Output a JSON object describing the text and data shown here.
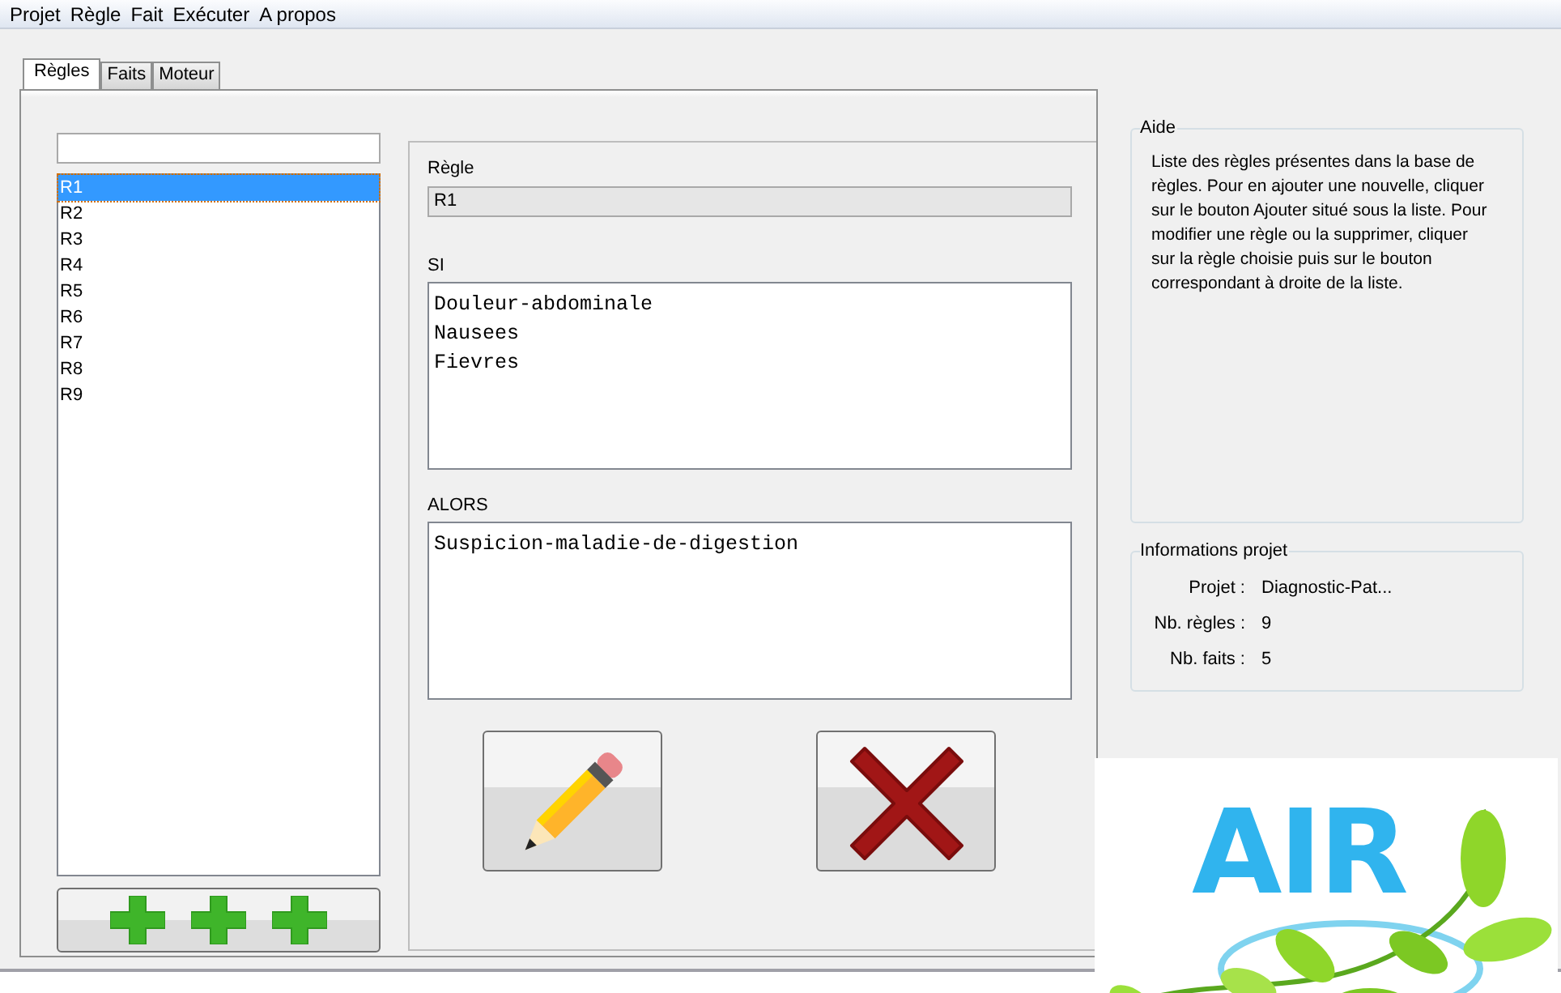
{
  "menu": [
    "Projet",
    "Règle",
    "Fait",
    "Exécuter",
    "A propos"
  ],
  "tabs": [
    {
      "label": "Règles",
      "selected": true
    },
    {
      "label": "Faits",
      "selected": false
    },
    {
      "label": "Moteur",
      "selected": false
    }
  ],
  "rules": [
    {
      "label": "R1",
      "selected": true
    },
    {
      "label": "R2",
      "selected": false
    },
    {
      "label": "R3",
      "selected": false
    },
    {
      "label": "R4",
      "selected": false
    },
    {
      "label": "R5",
      "selected": false
    },
    {
      "label": "R6",
      "selected": false
    },
    {
      "label": "R7",
      "selected": false
    },
    {
      "label": "R8",
      "selected": false
    },
    {
      "label": "R9",
      "selected": false
    }
  ],
  "editor": {
    "rule_label": "Règle",
    "rule_value": "R1",
    "if_label": "SI",
    "if_lines": [
      "Douleur-abdominale",
      "Nausees",
      "Fievres"
    ],
    "then_label": "ALORS",
    "then_lines": [
      "Suspicion-maladie-de-digestion"
    ]
  },
  "help": {
    "title": "Aide",
    "text": "Liste des règles présentes dans la base de règles. Pour en ajouter une nouvelle, cliquer sur le bouton Ajouter situé sous la liste. Pour modifier une règle ou la supprimer, cliquer sur la règle choisie puis sur le bouton correspondant à droite de la liste."
  },
  "project_info": {
    "title": "Informations projet",
    "rows": [
      {
        "label": "Projet :",
        "value": "Diagnostic-Pat..."
      },
      {
        "label": "Nb. règles :",
        "value": "9"
      },
      {
        "label": "Nb. faits :",
        "value": "5"
      }
    ]
  },
  "logo": {
    "text": "AIR"
  }
}
